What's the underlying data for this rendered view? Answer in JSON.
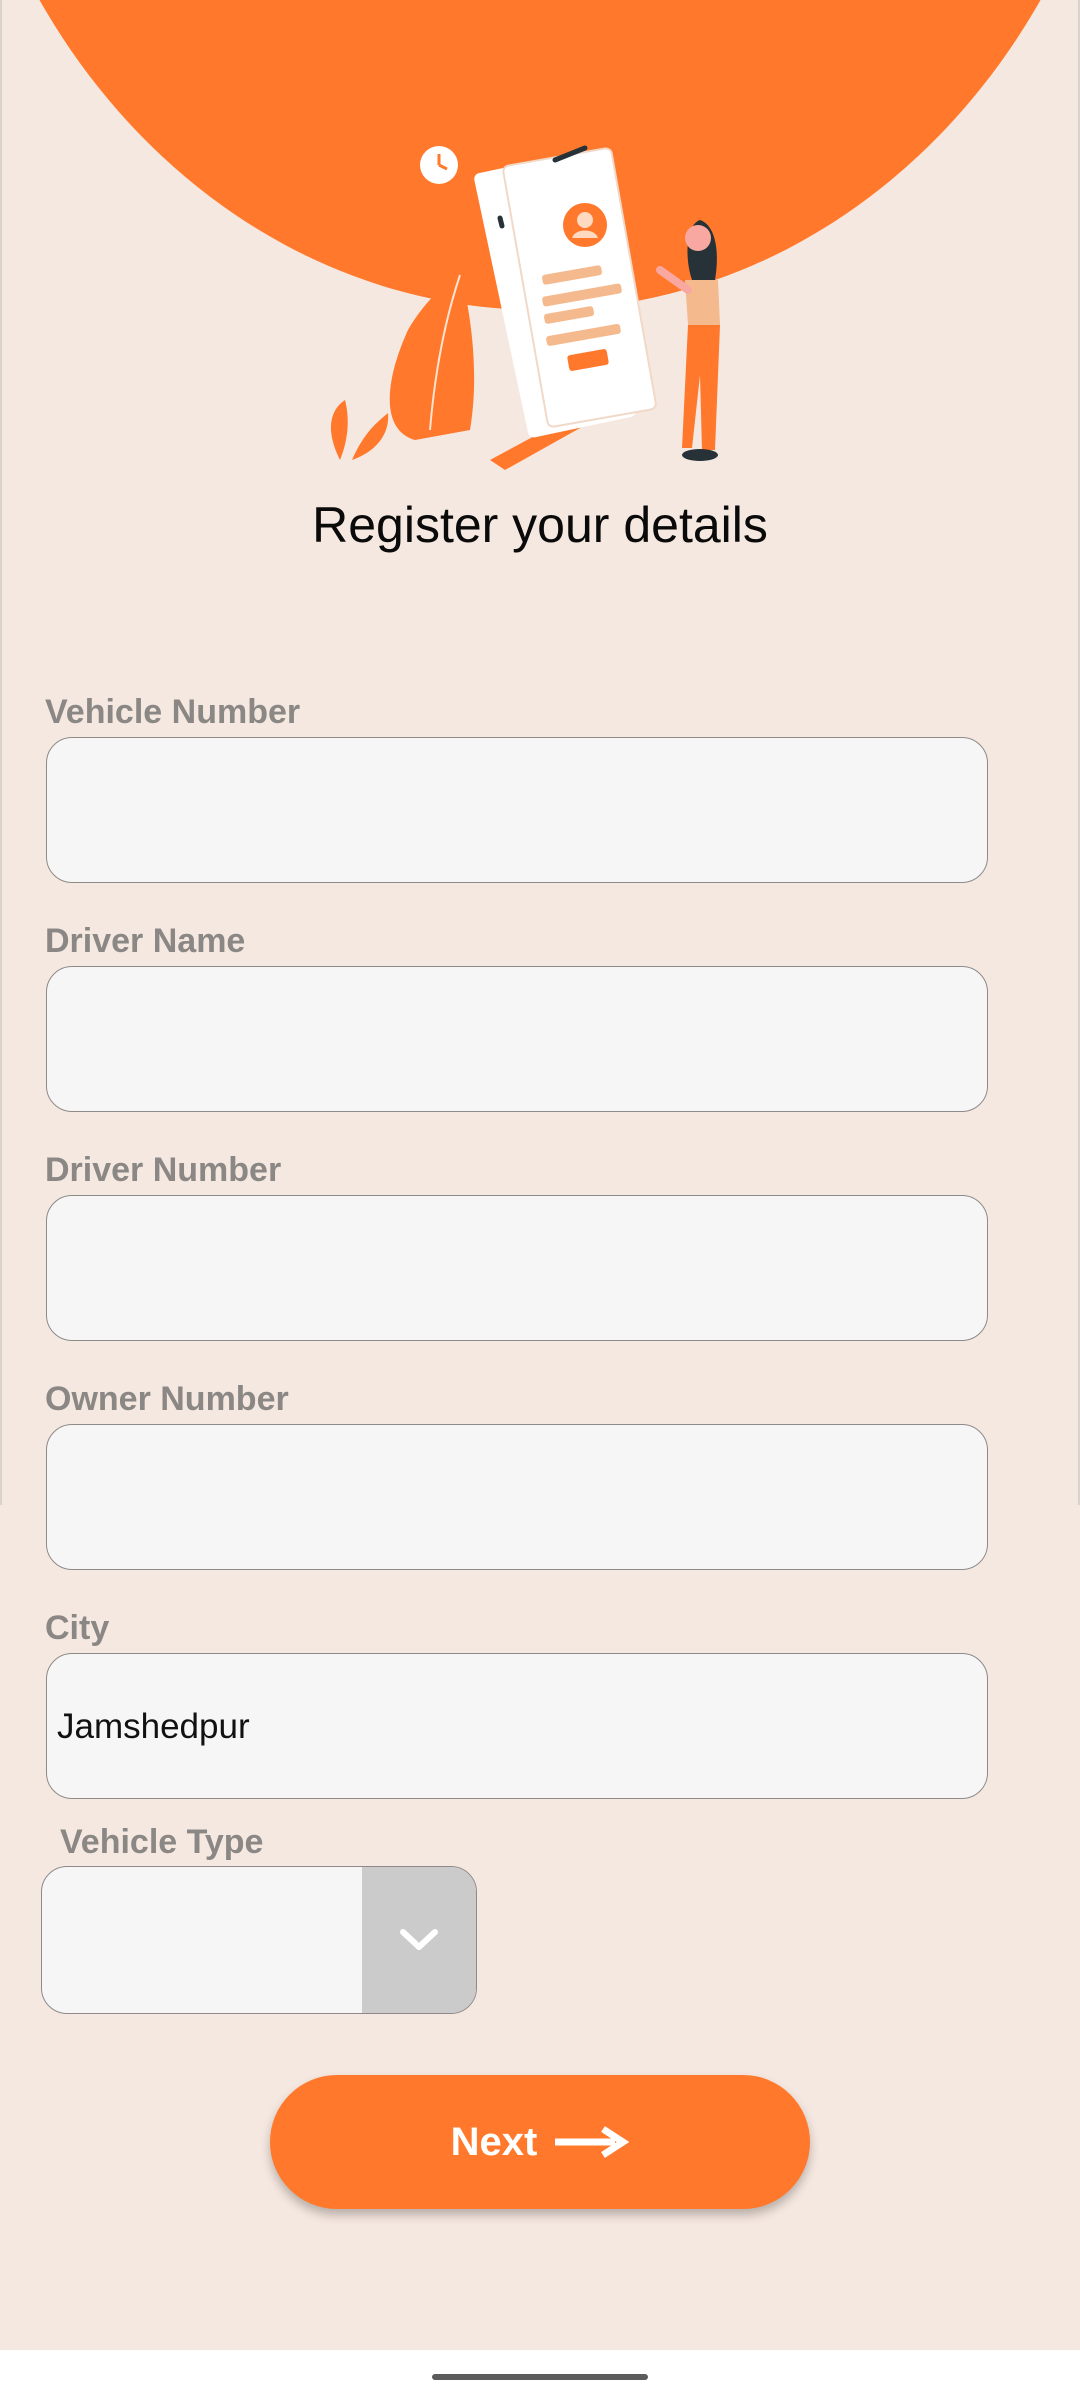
{
  "header": {
    "title": "Register your details"
  },
  "form": {
    "vehicle_number": {
      "label": "Vehicle Number",
      "value": ""
    },
    "driver_name": {
      "label": "Driver Name",
      "value": ""
    },
    "driver_number": {
      "label": "Driver Number",
      "value": ""
    },
    "owner_number": {
      "label": "Owner Number",
      "value": ""
    },
    "city": {
      "label": "City",
      "value": "Jamshedpur"
    },
    "vehicle_type": {
      "label": "Vehicle Type",
      "value": ""
    }
  },
  "next_button": {
    "label": "Next",
    "icon": "arrow-right-icon"
  },
  "icons": {
    "dropdown": "chevron-down-icon",
    "illustration": "registration-illustration"
  },
  "colors": {
    "accent": "#ff782b",
    "background": "#f5e8e0",
    "field_background": "#f6f6f6",
    "label": "#8a8785",
    "dropdown_button": "#cbcbcb"
  }
}
